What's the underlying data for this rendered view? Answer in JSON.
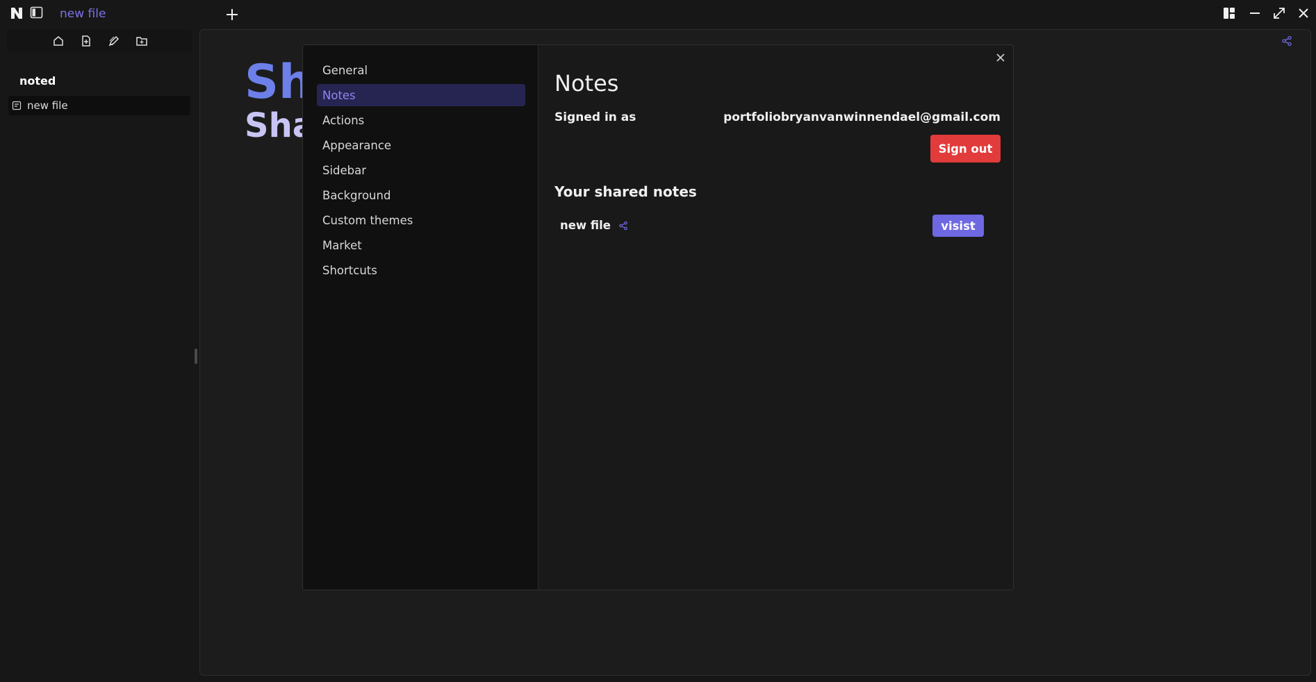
{
  "titlebar": {
    "tab_title": "new file"
  },
  "sidebar": {
    "workspace_name": "noted",
    "files": [
      {
        "label": "new file"
      }
    ]
  },
  "editor": {
    "heading_1": "Sh",
    "heading_2": "Sha"
  },
  "settings_modal": {
    "nav_items": [
      {
        "label": "General"
      },
      {
        "label": "Notes"
      },
      {
        "label": "Actions"
      },
      {
        "label": "Appearance"
      },
      {
        "label": "Sidebar"
      },
      {
        "label": "Background"
      },
      {
        "label": "Custom themes"
      },
      {
        "label": "Market"
      },
      {
        "label": "Shortcuts"
      }
    ],
    "active_nav": "Notes",
    "title": "Notes",
    "signed_in_label": "Signed in as",
    "signed_in_email": "portfoliobryanvanwinnendael@gmail.com",
    "sign_out_label": "Sign out",
    "shared_title": "Your shared notes",
    "shared_notes": [
      {
        "name": "new file",
        "action_label": "visist"
      }
    ]
  },
  "colors": {
    "accent": "#6e68e2",
    "danger": "#e23b3b",
    "heading_blue": "#6d7fe8"
  }
}
